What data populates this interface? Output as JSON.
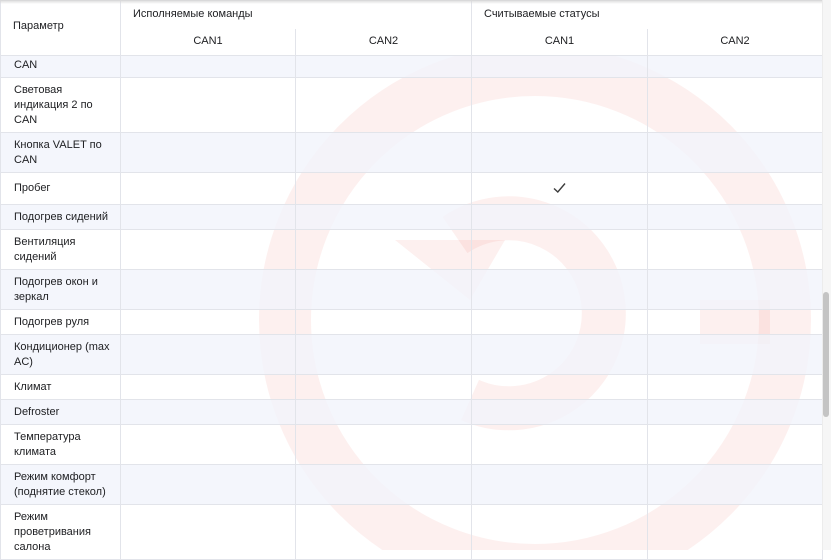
{
  "table": {
    "header": {
      "param_label": "Параметр",
      "group_commands": "Исполняемые команды",
      "group_statuses": "Считываемые статусы",
      "can1": "CAN1",
      "can2": "CAN2"
    },
    "rows": [
      {
        "param": "CAN",
        "cmd_can1": "",
        "cmd_can2": "",
        "st_can1": "",
        "st_can2": ""
      },
      {
        "param": "Световая индикация 2 по CAN",
        "cmd_can1": "",
        "cmd_can2": "",
        "st_can1": "",
        "st_can2": ""
      },
      {
        "param": "Кнопка VALET по CAN",
        "cmd_can1": "",
        "cmd_can2": "",
        "st_can1": "",
        "st_can2": ""
      },
      {
        "param": "Пробег",
        "cmd_can1": "",
        "cmd_can2": "",
        "st_can1": "check-icon",
        "st_can2": ""
      },
      {
        "param": "Подогрев сидений",
        "cmd_can1": "",
        "cmd_can2": "",
        "st_can1": "",
        "st_can2": ""
      },
      {
        "param": "Вентиляция сидений",
        "cmd_can1": "",
        "cmd_can2": "",
        "st_can1": "",
        "st_can2": ""
      },
      {
        "param": "Подогрев окон и зеркал",
        "cmd_can1": "",
        "cmd_can2": "",
        "st_can1": "",
        "st_can2": ""
      },
      {
        "param": "Подогрев руля",
        "cmd_can1": "",
        "cmd_can2": "",
        "st_can1": "",
        "st_can2": ""
      },
      {
        "param": "Кондиционер (max AC)",
        "cmd_can1": "",
        "cmd_can2": "",
        "st_can1": "",
        "st_can2": ""
      },
      {
        "param": "Климат",
        "cmd_can1": "",
        "cmd_can2": "",
        "st_can1": "",
        "st_can2": ""
      },
      {
        "param": "Defroster",
        "cmd_can1": "",
        "cmd_can2": "",
        "st_can1": "",
        "st_can2": ""
      },
      {
        "param": "Температура климата",
        "cmd_can1": "",
        "cmd_can2": "",
        "st_can1": "",
        "st_can2": ""
      },
      {
        "param": "Режим комфорт (поднятие стекол)",
        "cmd_can1": "",
        "cmd_can2": "",
        "st_can1": "",
        "st_can2": ""
      },
      {
        "param": "Режим проветривания салона",
        "cmd_can1": "",
        "cmd_can2": "",
        "st_can1": "",
        "st_can2": ""
      }
    ]
  },
  "colors": {
    "watermark": "#e83a2a",
    "alt_row": "#f1f3fb",
    "border": "#e2e4ea",
    "check": "#3c3c3c"
  },
  "icons": {
    "watermark": "brand-logo-icon",
    "check": "check-icon"
  }
}
